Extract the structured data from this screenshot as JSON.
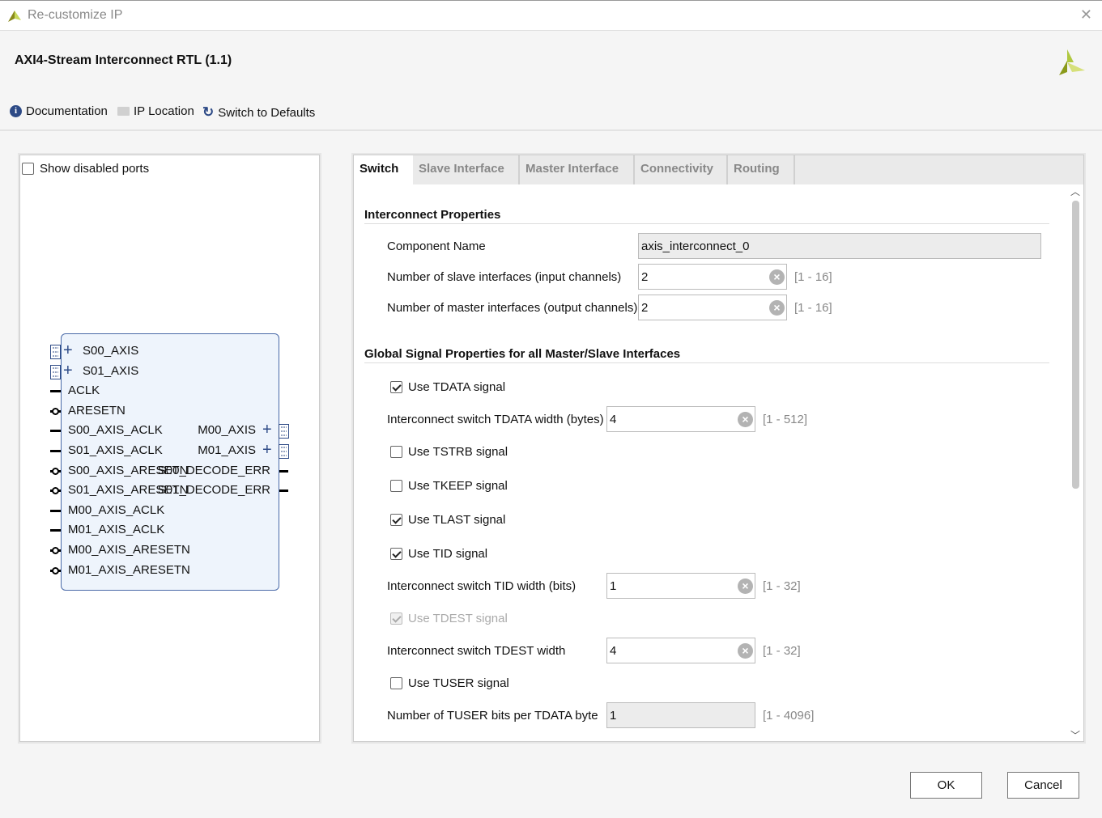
{
  "window": {
    "title": "Re-customize IP",
    "close_icon": "close-icon"
  },
  "ip_title": "AXI4-Stream Interconnect RTL (1.1)",
  "toolbar": {
    "documentation": "Documentation",
    "ip_location": "IP Location",
    "switch_defaults": "Switch to Defaults"
  },
  "left_panel": {
    "show_disabled_ports": "Show disabled ports",
    "show_disabled_checked": false
  },
  "block": {
    "left_ports": [
      {
        "name": "S00_AXIS",
        "type": "bus"
      },
      {
        "name": "S01_AXIS",
        "type": "bus"
      },
      {
        "name": "ACLK",
        "type": "clock"
      },
      {
        "name": "ARESETN",
        "type": "reset"
      },
      {
        "name": "S00_AXIS_ACLK",
        "type": "clock"
      },
      {
        "name": "S01_AXIS_ACLK",
        "type": "clock"
      },
      {
        "name": "S00_AXIS_ARESETN",
        "type": "reset"
      },
      {
        "name": "S01_AXIS_ARESETN",
        "type": "reset"
      },
      {
        "name": "M00_AXIS_ACLK",
        "type": "clock"
      },
      {
        "name": "M01_AXIS_ACLK",
        "type": "clock"
      },
      {
        "name": "M00_AXIS_ARESETN",
        "type": "reset"
      },
      {
        "name": "M01_AXIS_ARESETN",
        "type": "reset"
      }
    ],
    "right_ports": [
      {
        "name": "M00_AXIS",
        "type": "bus",
        "row": 4
      },
      {
        "name": "M01_AXIS",
        "type": "bus",
        "row": 5
      },
      {
        "name": "S00_DECODE_ERR",
        "type": "signal",
        "row": 6
      },
      {
        "name": "S01_DECODE_ERR",
        "type": "signal",
        "row": 7
      }
    ]
  },
  "tabs": [
    "Switch",
    "Slave Interface",
    "Master Interface",
    "Connectivity",
    "Routing"
  ],
  "active_tab": "Switch",
  "form": {
    "section1": "Interconnect Properties",
    "component_name_label": "Component Name",
    "component_name": "axis_interconnect_0",
    "num_slave_label": "Number of slave interfaces (input channels)",
    "num_slave": "2",
    "num_slave_range": "[1 - 16]",
    "num_master_label": "Number of master interfaces (output channels)",
    "num_master": "2",
    "num_master_range": "[1 - 16]",
    "section2": "Global Signal Properties for all Master/Slave Interfaces",
    "use_tdata": "Use TDATA signal",
    "use_tdata_checked": true,
    "tdata_width_label": "Interconnect switch TDATA width (bytes)",
    "tdata_width": "4",
    "tdata_width_range": "[1 - 512]",
    "use_tstrb": "Use TSTRB signal",
    "use_tstrb_checked": false,
    "use_tkeep": "Use TKEEP signal",
    "use_tkeep_checked": false,
    "use_tlast": "Use TLAST signal",
    "use_tlast_checked": true,
    "use_tid": "Use TID signal",
    "use_tid_checked": true,
    "tid_width_label": "Interconnect switch TID width (bits)",
    "tid_width": "1",
    "tid_width_range": "[1 - 32]",
    "use_tdest": "Use TDEST signal",
    "use_tdest_checked": true,
    "use_tdest_disabled": true,
    "tdest_width_label": "Interconnect switch TDEST width",
    "tdest_width": "4",
    "tdest_width_range": "[1 - 32]",
    "use_tuser": "Use TUSER signal",
    "use_tuser_checked": false,
    "tuser_bits_label": "Number of TUSER bits per TDATA byte",
    "tuser_bits": "1",
    "tuser_bits_range": "[1 - 4096]"
  },
  "buttons": {
    "ok": "OK",
    "cancel": "Cancel"
  },
  "colors": {
    "accent": "#2d4a86",
    "brand_logo": "#9ab93a"
  }
}
